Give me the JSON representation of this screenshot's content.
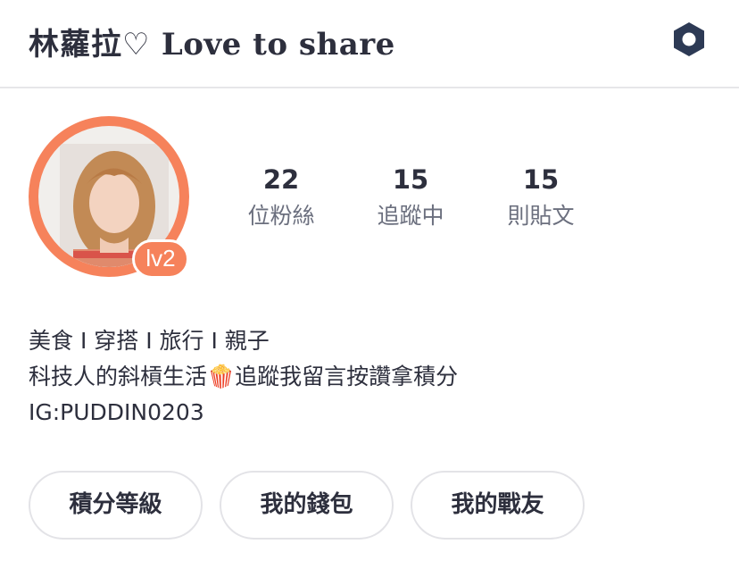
{
  "header": {
    "title_cjk": "林蘿拉♡",
    "title_latin": " Love to share",
    "settings_icon": "hexagon-settings-icon",
    "icon_color": "#2d3a55"
  },
  "profile": {
    "level": "lv2",
    "accent_color": "#f6825b",
    "stats": [
      {
        "value": "22",
        "label": "位粉絲"
      },
      {
        "value": "15",
        "label": "追蹤中"
      },
      {
        "value": "15",
        "label": "則貼文"
      }
    ],
    "bio": {
      "line1": "美食 I 穿搭 I 旅行 I 親子",
      "line2": "科技人的斜槓生活🍿追蹤我留言按讚拿積分",
      "line3": "IG:PUDDIN0203"
    }
  },
  "actions": {
    "points_label": "積分等級",
    "wallet_label": "我的錢包",
    "friends_label": "我的戰友"
  }
}
